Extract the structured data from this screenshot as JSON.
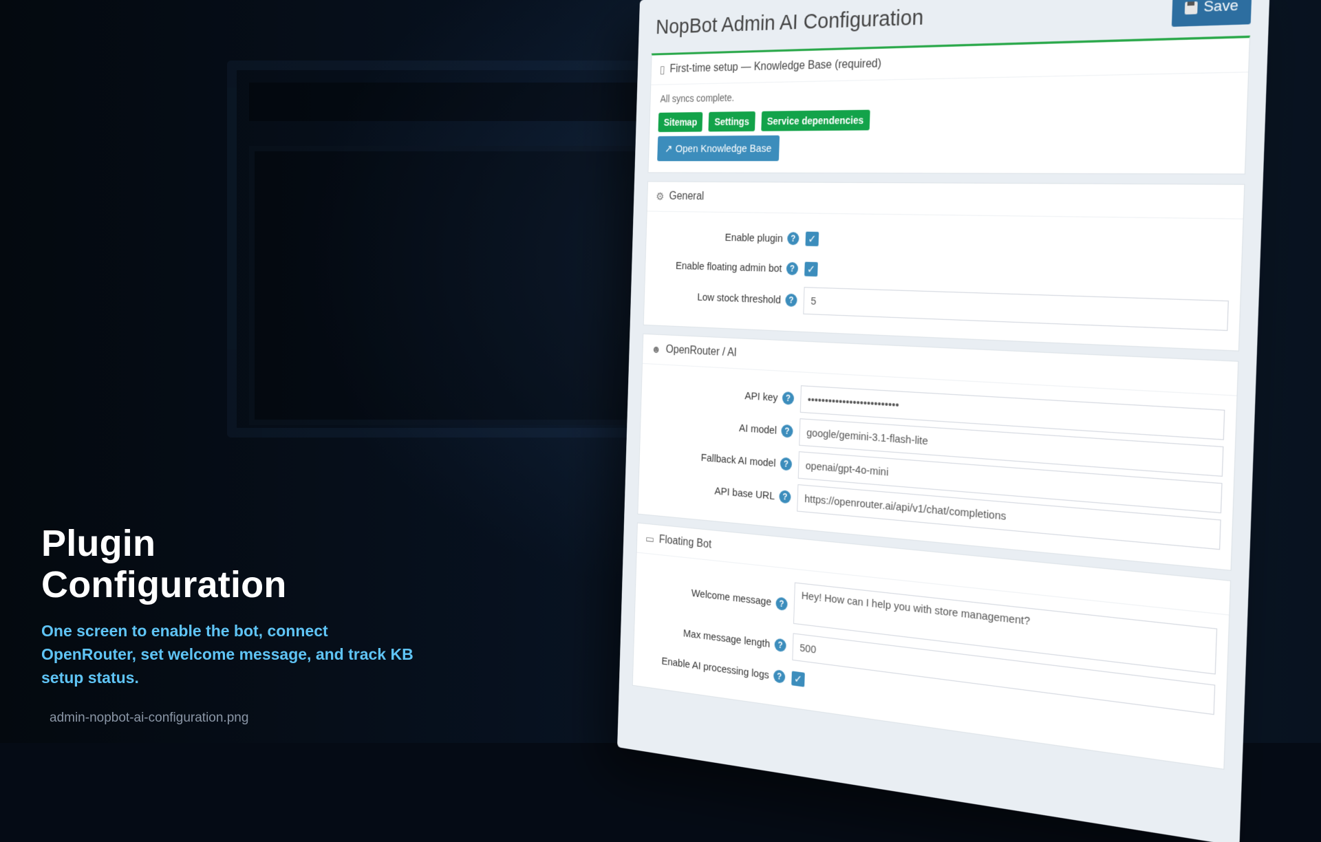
{
  "hero": {
    "title_line1": "Plugin",
    "title_line2": "Configuration",
    "subtitle": "One screen to enable the bot, connect OpenRouter, set welcome message, and track KB setup status.",
    "filename": "admin-nopbot-ai-configuration.png"
  },
  "page": {
    "title": "NopBot Admin AI Configuration",
    "save_label": "Save",
    "accent_color": "#2aa84a",
    "primary_color": "#3c8dbc"
  },
  "kb_setup": {
    "title": "First-time setup — Knowledge Base (required)",
    "status_text": "All syncs complete.",
    "buttons": {
      "sitemap": "Sitemap",
      "settings": "Settings",
      "service_deps": "Service dependencies"
    },
    "open_kb": "Open Knowledge Base"
  },
  "general": {
    "title": "General",
    "enable_plugin_label": "Enable plugin",
    "enable_plugin_checked": true,
    "enable_floating_label": "Enable floating admin bot",
    "enable_floating_checked": true,
    "low_stock_label": "Low stock threshold",
    "low_stock_value": "5"
  },
  "openrouter": {
    "title": "OpenRouter / AI",
    "api_key_label": "API key",
    "api_key_value": "••••••••••••••••••••••••••",
    "ai_model_label": "AI model",
    "ai_model_value": "google/gemini-3.1-flash-lite",
    "fallback_label": "Fallback AI model",
    "fallback_value": "openai/gpt-4o-mini",
    "base_url_label": "API base URL",
    "base_url_value": "https://openrouter.ai/api/v1/chat/completions"
  },
  "floating_bot": {
    "title": "Floating Bot",
    "welcome_label": "Welcome message",
    "welcome_value": "Hey! How can I help you with store management?",
    "max_len_label": "Max message length",
    "max_len_value": "500",
    "logs_label": "Enable AI processing logs",
    "logs_checked": true
  },
  "icons": {
    "help": "?",
    "check": "✓",
    "kb": "▯",
    "gear": "⚙",
    "robot": "☻",
    "chat": "▭",
    "external": "↗"
  }
}
